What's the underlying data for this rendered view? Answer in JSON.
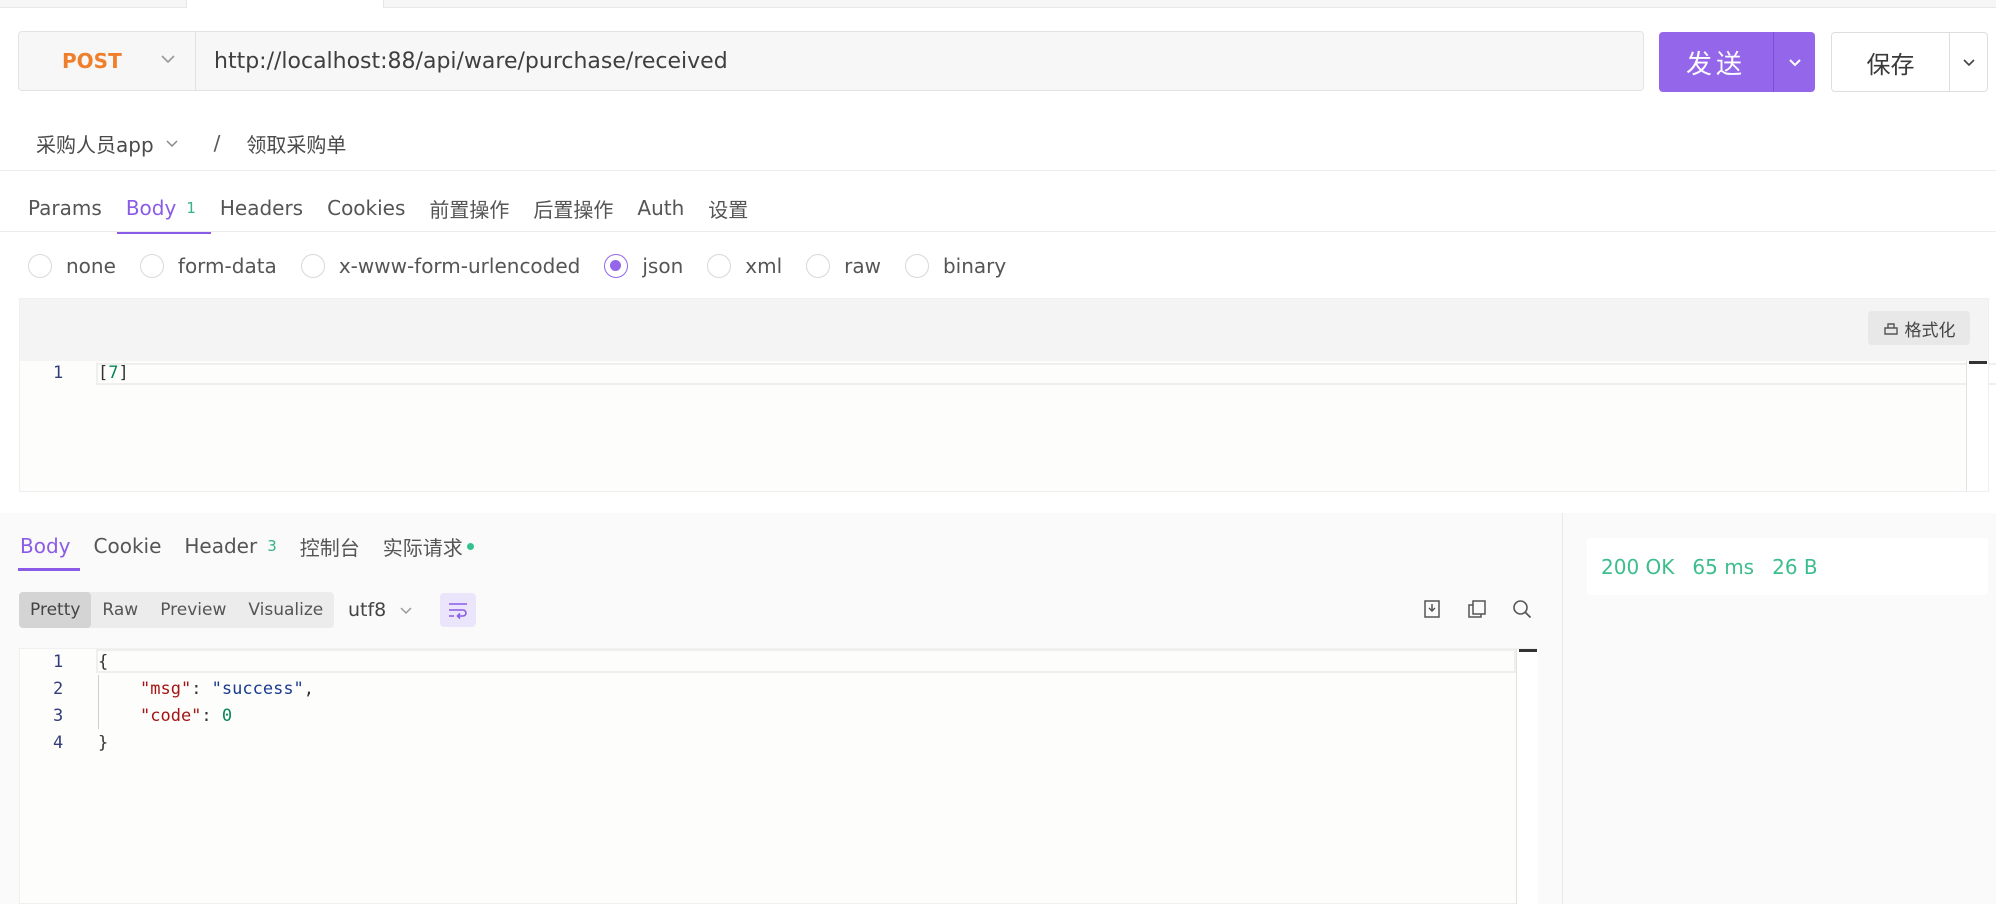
{
  "request": {
    "method": "POST",
    "url": "http://localhost:88/api/ware/purchase/received",
    "send_label": "发送",
    "save_label": "保存"
  },
  "breadcrumb": {
    "folder": "采购人员app",
    "separator": "/",
    "name": "领取采购单"
  },
  "request_tabs": [
    {
      "label": "Params"
    },
    {
      "label": "Body",
      "badge": "1",
      "active": true
    },
    {
      "label": "Headers"
    },
    {
      "label": "Cookies"
    },
    {
      "label": "前置操作"
    },
    {
      "label": "后置操作"
    },
    {
      "label": "Auth"
    },
    {
      "label": "设置"
    }
  ],
  "body_types": [
    {
      "label": "none"
    },
    {
      "label": "form-data"
    },
    {
      "label": "x-www-form-urlencoded"
    },
    {
      "label": "json",
      "checked": true
    },
    {
      "label": "xml"
    },
    {
      "label": "raw"
    },
    {
      "label": "binary"
    }
  ],
  "editor": {
    "format_label": "格式化",
    "lines": [
      {
        "num": "1",
        "open": "[",
        "value": "7",
        "close": "]"
      }
    ]
  },
  "response_tabs": [
    {
      "label": "Body",
      "active": true
    },
    {
      "label": "Cookie"
    },
    {
      "label": "Header",
      "badge": "3"
    },
    {
      "label": "控制台"
    },
    {
      "label": "实际请求",
      "dot": true
    }
  ],
  "view_modes": [
    {
      "label": "Pretty",
      "active": true
    },
    {
      "label": "Raw"
    },
    {
      "label": "Preview"
    },
    {
      "label": "Visualize"
    }
  ],
  "encoding": "utf8",
  "response": {
    "line_numbers": [
      "1",
      "2",
      "3",
      "4"
    ],
    "open_brace": "{",
    "close_brace": "}",
    "msg_key": "\"msg\"",
    "msg_value": "\"success\"",
    "code_key": "\"code\"",
    "code_value": "0"
  },
  "status": {
    "code": "200 OK",
    "time": "65 ms",
    "size": "26 B"
  },
  "colors": {
    "accent": "#9466ea",
    "method": "#ef7f2b",
    "success": "#3dbd8e"
  }
}
